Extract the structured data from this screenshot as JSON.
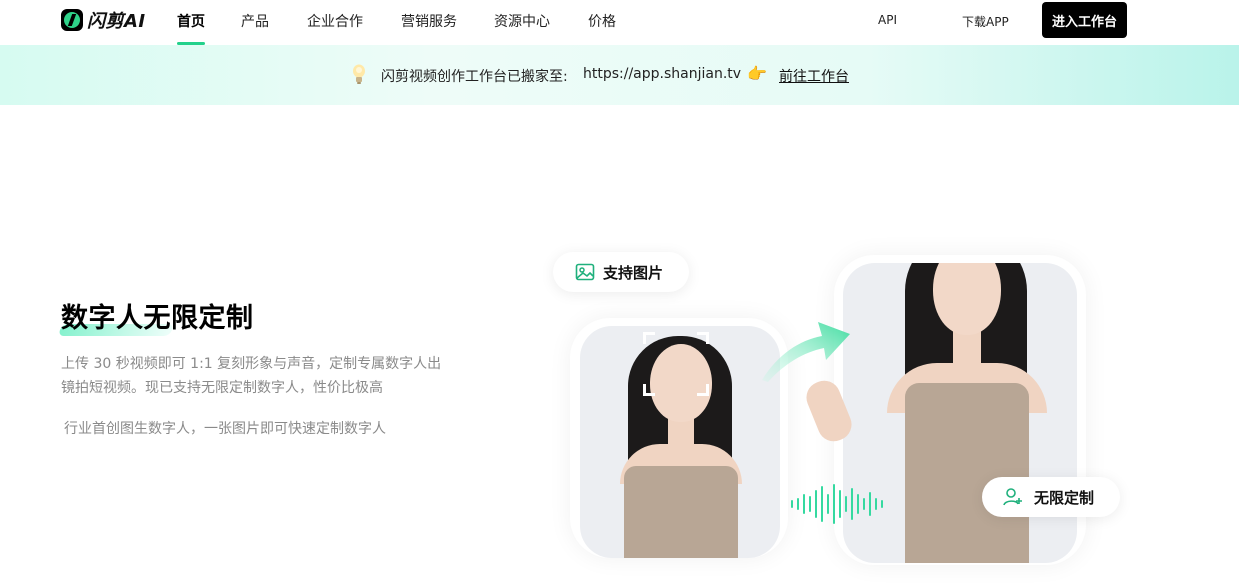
{
  "nav": {
    "logo_text": "闪剪AI",
    "items": [
      {
        "label": "首页",
        "active": true
      },
      {
        "label": "产品"
      },
      {
        "label": "企业合作"
      },
      {
        "label": "营销服务"
      },
      {
        "label": "资源中心"
      },
      {
        "label": "价格"
      }
    ],
    "api_label": "API",
    "download_label": "下载APP",
    "enter_label": "进入工作台"
  },
  "banner": {
    "text": "闪剪视频创作工作台已搬家至:",
    "url": "https://app.shanjian.tv",
    "link_label": "前往工作台"
  },
  "hero": {
    "title": "数字人无限定制",
    "description": "上传 30 秒视频即可 1:1 复刻形象与声音，定制专属数字人出镜拍短视频。现已支持无限定制数字人，性价比极高",
    "description2": "行业首创图生数字人，一张图片即可快速定制数字人",
    "badge_support": "支持图片",
    "badge_custom": "无限定制"
  },
  "colors": {
    "accent": "#23d18b",
    "button_bg": "#000000"
  }
}
